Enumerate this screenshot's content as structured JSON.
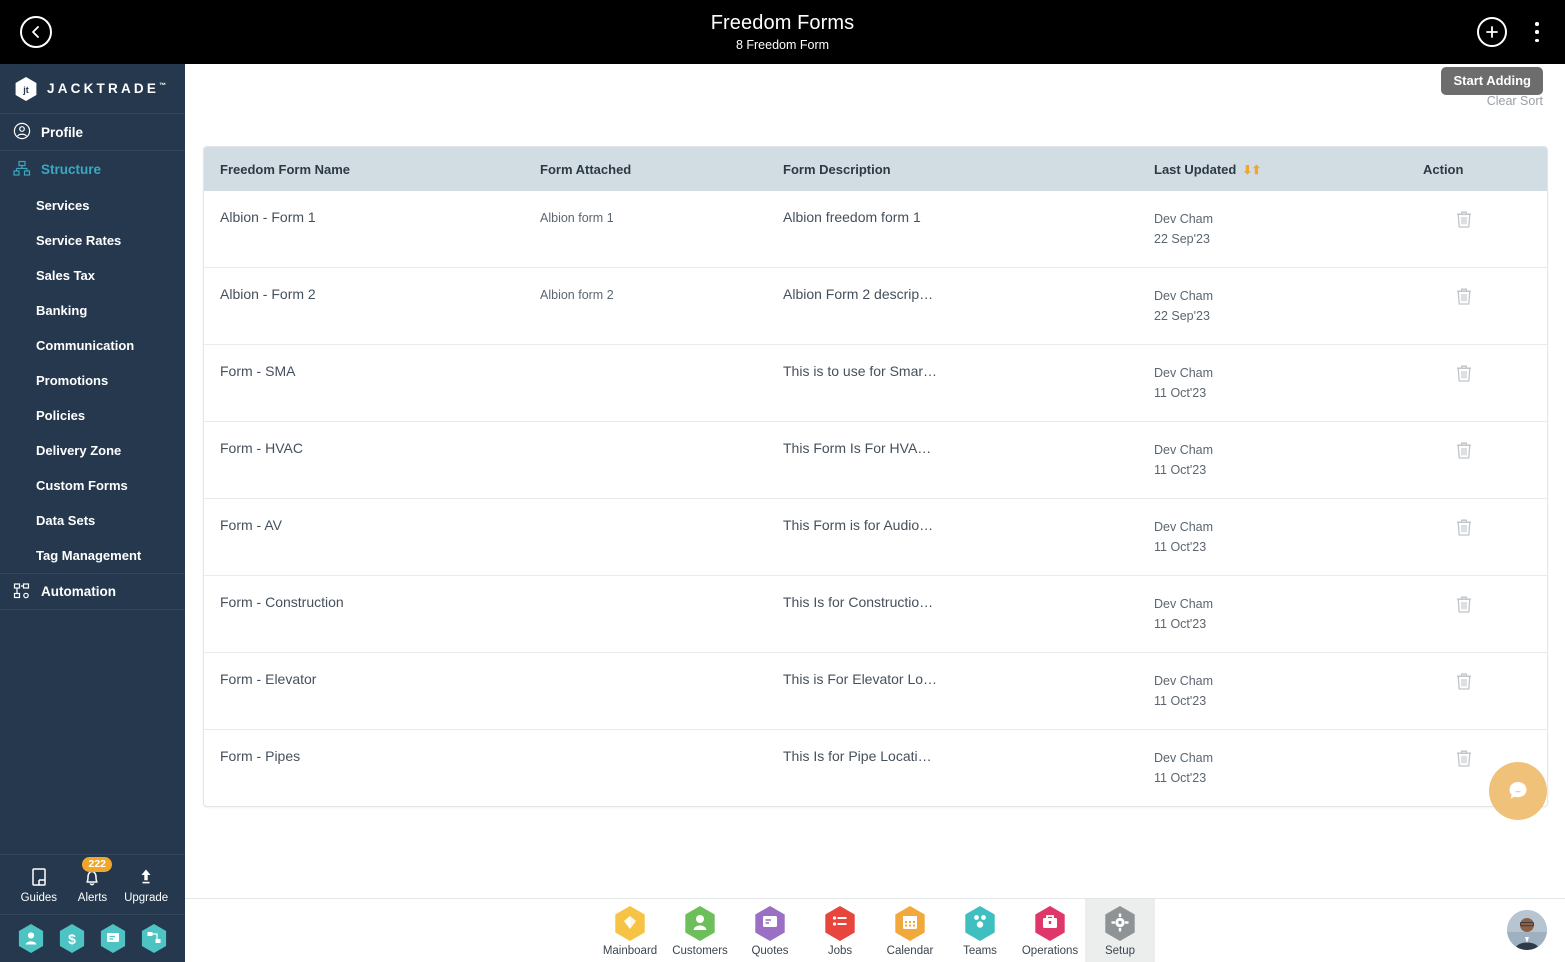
{
  "topbar": {
    "back_icon": "chevron-left-icon",
    "title": "Freedom Forms",
    "subtitle": "8 Freedom Form",
    "add_icon": "plus-circle-icon",
    "menu_icon": "kebab-menu-icon"
  },
  "sidebar": {
    "brand": "JACKTRADE",
    "brand_tm": "™",
    "items": [
      {
        "label": "Profile",
        "icon": "user-circle-icon",
        "type": "top",
        "active": false
      },
      {
        "label": "Structure",
        "icon": "structure-icon",
        "type": "top",
        "active": true
      },
      {
        "label": "Services",
        "icon": "",
        "type": "sub",
        "active": false
      },
      {
        "label": "Service Rates",
        "icon": "",
        "type": "sub",
        "active": false
      },
      {
        "label": "Sales Tax",
        "icon": "",
        "type": "sub",
        "active": false
      },
      {
        "label": "Banking",
        "icon": "",
        "type": "sub",
        "active": false
      },
      {
        "label": "Communication",
        "icon": "",
        "type": "sub",
        "active": false
      },
      {
        "label": "Promotions",
        "icon": "",
        "type": "sub",
        "active": false
      },
      {
        "label": "Policies",
        "icon": "",
        "type": "sub",
        "active": false
      },
      {
        "label": "Delivery Zone",
        "icon": "",
        "type": "sub",
        "active": false
      },
      {
        "label": "Custom Forms",
        "icon": "",
        "type": "sub",
        "active": false
      },
      {
        "label": "Data Sets",
        "icon": "",
        "type": "sub",
        "active": false
      },
      {
        "label": "Tag Management",
        "icon": "",
        "type": "sub",
        "active": false
      },
      {
        "label": "Automation",
        "icon": "automation-icon",
        "type": "top",
        "active": false
      }
    ],
    "tools": [
      {
        "label": "Guides",
        "icon": "book-icon",
        "badge": ""
      },
      {
        "label": "Alerts",
        "icon": "bell-icon",
        "badge": "222"
      },
      {
        "label": "Upgrade",
        "icon": "arrow-up-icon",
        "badge": ""
      }
    ],
    "quick_icons": [
      "person-hex-icon",
      "dollar-hex-icon",
      "quotes-hex-icon",
      "workflow-hex-icon"
    ]
  },
  "toolbar": {
    "clear_sort_label": "Clear Sort",
    "tooltip_label": "Start Adding"
  },
  "table": {
    "columns": [
      "Freedom Form Name",
      "Form Attached",
      "Form Description",
      "Last Updated",
      "Action"
    ],
    "sort_column_index": 3,
    "sort_icon": "sort-updown-icon",
    "delete_icon": "trash-icon",
    "rows": [
      {
        "name": "Albion - Form 1",
        "attached": "Albion form 1",
        "description": "Albion freedom form 1",
        "updated_by": "Dev Cham",
        "updated_on": "22 Sep'23"
      },
      {
        "name": "Albion - Form 2",
        "attached": "Albion form 2",
        "description": "Albion Form 2 descrip…",
        "updated_by": "Dev Cham",
        "updated_on": "22 Sep'23"
      },
      {
        "name": "Form - SMA",
        "attached": "",
        "description": "This is to use for Smar…",
        "updated_by": "Dev Cham",
        "updated_on": "11 Oct'23"
      },
      {
        "name": "Form - HVAC",
        "attached": "",
        "description": "This Form Is For HVA…",
        "updated_by": "Dev Cham",
        "updated_on": "11 Oct'23"
      },
      {
        "name": "Form - AV",
        "attached": "",
        "description": "This Form is for Audio…",
        "updated_by": "Dev Cham",
        "updated_on": "11 Oct'23"
      },
      {
        "name": "Form - Construction",
        "attached": "",
        "description": "This Is for Constructio…",
        "updated_by": "Dev Cham",
        "updated_on": "11 Oct'23"
      },
      {
        "name": "Form - Elevator",
        "attached": "",
        "description": "This is For Elevator Lo…",
        "updated_by": "Dev Cham",
        "updated_on": "11 Oct'23"
      },
      {
        "name": "Form - Pipes",
        "attached": "",
        "description": "This Is for Pipe Locati…",
        "updated_by": "Dev Cham",
        "updated_on": "11 Oct'23"
      }
    ]
  },
  "chat": {
    "icon": "chat-bubble-icon",
    "color": "#f0c179"
  },
  "bottomnav": {
    "items": [
      {
        "label": "Mainboard",
        "icon": "mainboard-icon",
        "color": "#f6c344",
        "selected": false
      },
      {
        "label": "Customers",
        "icon": "customers-icon",
        "color": "#6cbf5a",
        "selected": false
      },
      {
        "label": "Quotes",
        "icon": "quotes-icon",
        "color": "#9b6fc4",
        "selected": false
      },
      {
        "label": "Jobs",
        "icon": "jobs-icon",
        "color": "#e8453c",
        "selected": false
      },
      {
        "label": "Calendar",
        "icon": "calendar-icon",
        "color": "#f2a93b",
        "selected": false
      },
      {
        "label": "Teams",
        "icon": "teams-icon",
        "color": "#3fbfbf",
        "selected": false
      },
      {
        "label": "Operations",
        "icon": "operations-icon",
        "color": "#e0376a",
        "selected": false
      },
      {
        "label": "Setup",
        "icon": "setup-icon",
        "color": "#8e9396",
        "selected": true
      }
    ],
    "avatar": "user-avatar"
  },
  "colors": {
    "sidebar_bg": "#25384d",
    "topbar_bg": "#000000",
    "table_header_bg": "#d2dde3",
    "accent_orange": "#f0a52b",
    "structure_active": "#3aa8c1"
  }
}
